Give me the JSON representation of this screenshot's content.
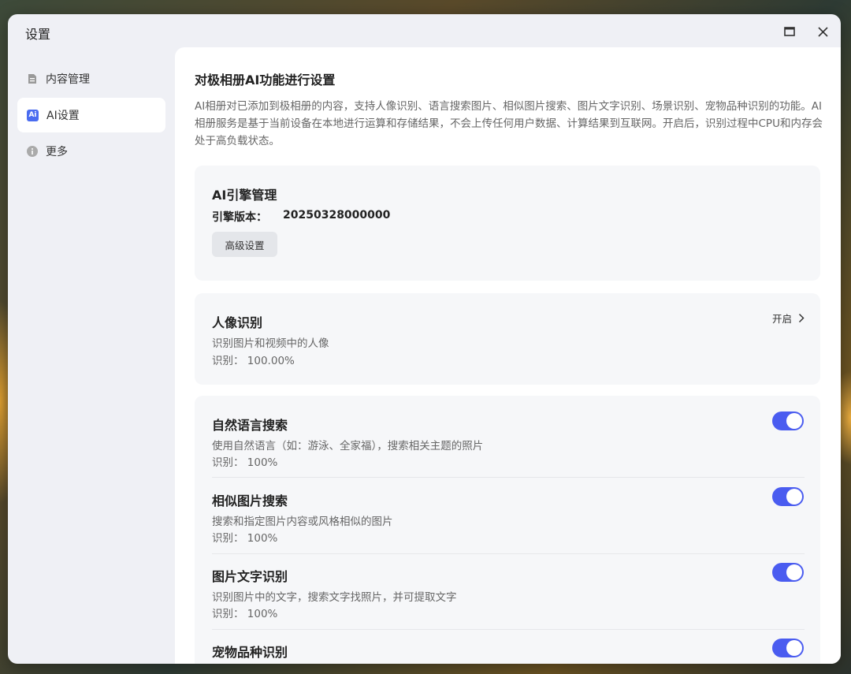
{
  "window": {
    "title": "设置"
  },
  "sidebar": {
    "items": [
      {
        "label": "内容管理",
        "icon": "document-icon"
      },
      {
        "label": "AI设置",
        "icon": "ai-icon",
        "active": true,
        "badge": "Ai"
      },
      {
        "label": "更多",
        "icon": "info-icon"
      }
    ]
  },
  "main": {
    "heading": "对极相册AI功能进行设置",
    "description": "AI相册对已添加到极相册的内容，支持人像识别、语言搜索图片、相似图片搜索、图片文字识别、场景识别、宠物品种识别的功能。AI相册服务是基于当前设备在本地进行运算和存储结果，不会上传任何用户数据、计算结果到互联网。开启后，识别过程中CPU和内存会处于高负载状态。",
    "engine": {
      "title": "AI引擎管理",
      "version_label": "引擎版本：",
      "version_value": "20250328000000",
      "advanced_button": "高级设置"
    },
    "portrait": {
      "title": "人像识别",
      "subtitle": "识别图片和视频中的人像",
      "progress": "识别： 100.00%",
      "status": "开启"
    },
    "features": [
      {
        "title": "自然语言搜索",
        "subtitle": "使用自然语言（如：游泳、全家福），搜索相关主题的照片",
        "progress": "识别： 100%",
        "enabled": true
      },
      {
        "title": "相似图片搜索",
        "subtitle": "搜索和指定图片内容或风格相似的图片",
        "progress": "识别： 100%",
        "enabled": true
      },
      {
        "title": "图片文字识别",
        "subtitle": "识别图片中的文字，搜索文字找照片，并可提取文字",
        "progress": "识别： 100%",
        "enabled": true
      },
      {
        "title": "宠物品种识别",
        "enabled": true
      }
    ]
  },
  "colors": {
    "accent": "#4a5cf0",
    "window_bg": "#eff0f5",
    "card_bg": "#f6f7f9"
  }
}
